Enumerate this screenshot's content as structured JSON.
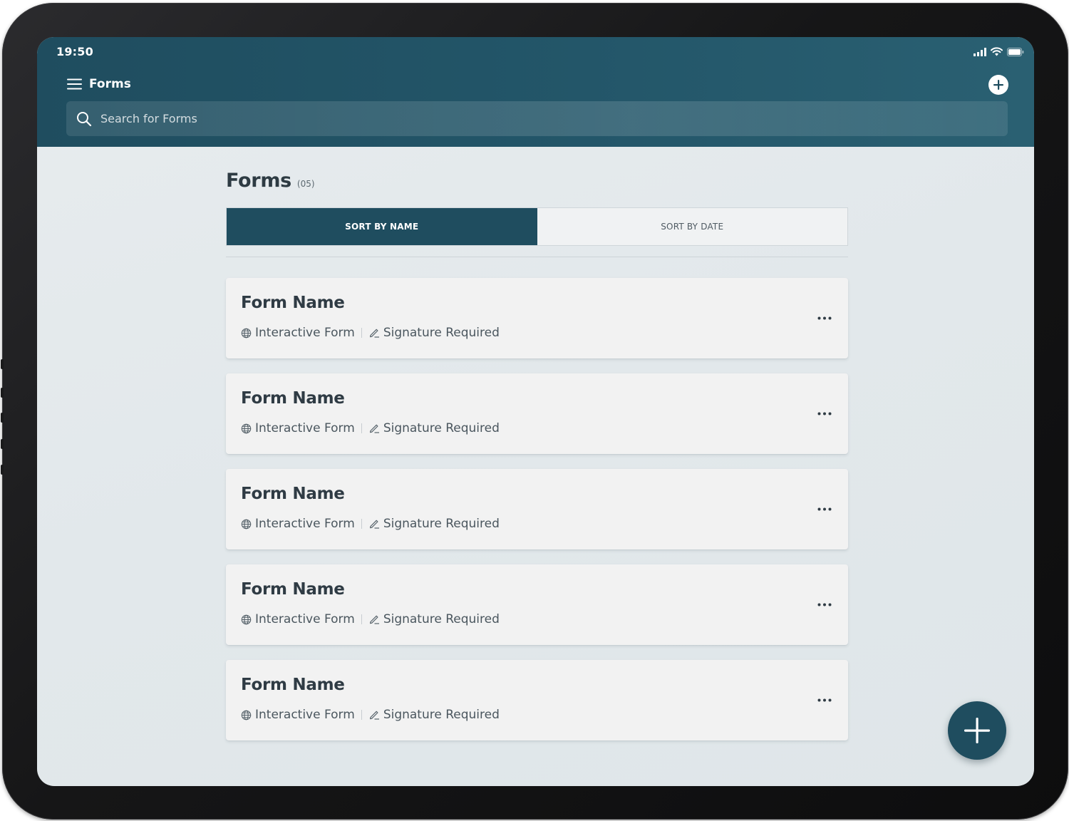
{
  "status_bar": {
    "time": "19:50",
    "icons": [
      "signal-icon",
      "wifi-icon",
      "battery-icon"
    ]
  },
  "header": {
    "title": "Forms",
    "menu_icon": "hamburger-menu-icon",
    "add_icon": "plus-circle-icon"
  },
  "search": {
    "placeholder": "Search for Forms",
    "value": ""
  },
  "main": {
    "title": "Forms",
    "count": "(05)",
    "sort": {
      "by_name": "SORT BY NAME",
      "by_date": "SORT BY DATE",
      "active": "by_name"
    },
    "forms": [
      {
        "name": "Form Name",
        "type": "Interactive Form",
        "signature": "Signature Required"
      },
      {
        "name": "Form Name",
        "type": "Interactive Form",
        "signature": "Signature Required"
      },
      {
        "name": "Form Name",
        "type": "Interactive Form",
        "signature": "Signature Required"
      },
      {
        "name": "Form Name",
        "type": "Interactive Form",
        "signature": "Signature Required"
      },
      {
        "name": "Form Name",
        "type": "Interactive Form",
        "signature": "Signature Required"
      }
    ]
  },
  "colors": {
    "primary": "#1f4d5f",
    "background": "#e4eaed",
    "card": "#f2f2f2",
    "text": "#2f3b44"
  }
}
